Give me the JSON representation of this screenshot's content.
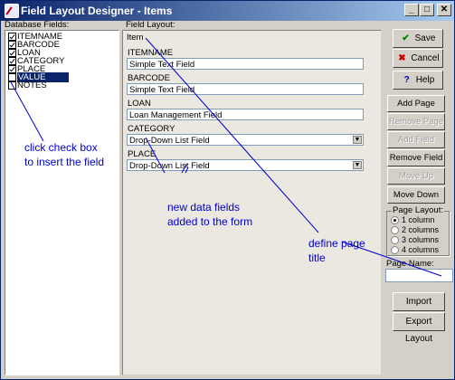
{
  "window": {
    "title": "Field Layout Designer - Items",
    "controls": [
      "_",
      "□",
      "✕"
    ]
  },
  "database_fields": {
    "label": "Database Fields:",
    "items": [
      {
        "name": "ITEMNAME",
        "checked": true,
        "selected": false
      },
      {
        "name": "BARCODE",
        "checked": true,
        "selected": false
      },
      {
        "name": "LOAN",
        "checked": true,
        "selected": false
      },
      {
        "name": "CATEGORY",
        "checked": true,
        "selected": false
      },
      {
        "name": "PLACE",
        "checked": true,
        "selected": false
      },
      {
        "name": "VALUE",
        "checked": false,
        "selected": true
      },
      {
        "name": "NOTES",
        "checked": false,
        "selected": false
      }
    ]
  },
  "field_layout": {
    "label": "Field Layout:",
    "page_title": "Item",
    "fields": [
      {
        "caption": "ITEMNAME",
        "value": "Simple Text Field",
        "dropdown": false
      },
      {
        "caption": "BARCODE",
        "value": "Simple Text Field",
        "dropdown": false
      },
      {
        "caption": "LOAN",
        "value": "Loan Management Field",
        "dropdown": false
      },
      {
        "caption": "CATEGORY",
        "value": "Drop-Down List Field",
        "dropdown": true
      },
      {
        "caption": "PLACE",
        "value": "Drop-Down List Field",
        "dropdown": true
      }
    ]
  },
  "buttons": {
    "save": "Save",
    "cancel": "Cancel",
    "help": "Help",
    "add_page": "Add Page",
    "remove_page": "Remove Page",
    "add_field": "Add Field",
    "remove_field": "Remove Field",
    "move_up": "Move Up",
    "move_down": "Move Down",
    "import_layout": "Import Layout",
    "export_layout": "Export Layout"
  },
  "page_layout": {
    "label": "Page Layout:",
    "options": [
      "1 column",
      "2 columns",
      "3 columns",
      "4 columns"
    ],
    "selected": "1 column"
  },
  "page_name": {
    "label": "Page Name:",
    "value": ""
  },
  "annotations": {
    "checkbox_note_1": "click check box",
    "checkbox_note_2": "to insert the field",
    "new_fields_1": "new data fields",
    "new_fields_2": "added to the form",
    "page_title_1": "define page",
    "page_title_2": "title"
  },
  "colors": {
    "title_bar": "#0a246a",
    "selection": "#0a246a",
    "annotation": "#0000cc",
    "save_icon": "#008000",
    "cancel_icon": "#cc0000",
    "help_icon": "#0000cc"
  }
}
